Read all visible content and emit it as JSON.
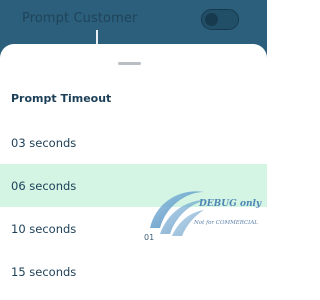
{
  "background": {
    "label": "Prompt Customer",
    "toggle_state": "off"
  },
  "sheet": {
    "title": "Prompt Timeout",
    "options": [
      {
        "label": "03 seconds",
        "selected": false
      },
      {
        "label": "06 seconds",
        "selected": true
      },
      {
        "label": "10 seconds",
        "selected": false
      },
      {
        "label": "15 seconds",
        "selected": false
      }
    ]
  },
  "watermark": {
    "debug_text": "DEBUG only",
    "commercial_text": "Not for COMMERCIAL",
    "number": "01"
  },
  "colors": {
    "top_bar": "#2b5f7c",
    "selected_row": "#d4f4e4",
    "text": "#1c3f57"
  }
}
